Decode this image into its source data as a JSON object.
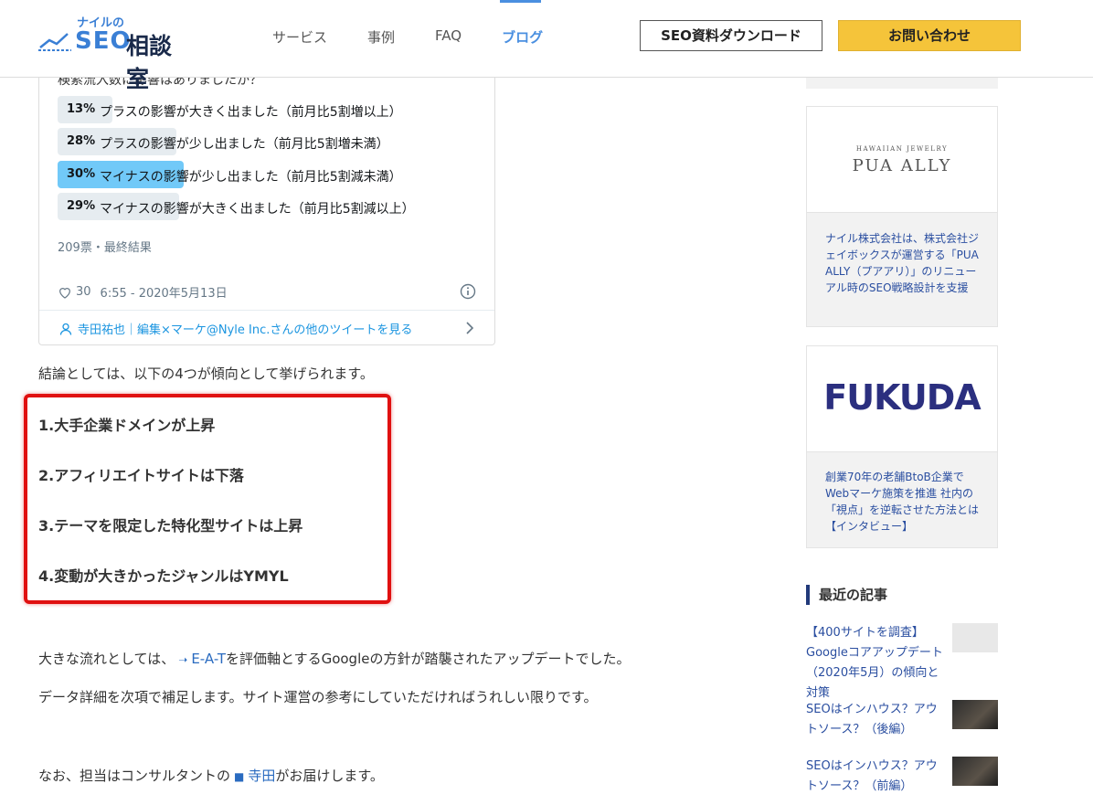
{
  "header": {
    "logo_small": "ナイルの",
    "logo_seo": "SEO",
    "logo_jp": "相談室",
    "nav": [
      {
        "label": "サービス"
      },
      {
        "label": "事例"
      },
      {
        "label": "FAQ"
      },
      {
        "label": "ブログ"
      }
    ],
    "download_button": "SEO資料ダウンロード",
    "contact_button": "お問い合わせ",
    "colors": {
      "accent": "#4a8fe0",
      "contact_bg": "#f5c43a"
    }
  },
  "tweet": {
    "question": "検索流入数に影響はありましたか？",
    "poll": [
      {
        "pct": "13%",
        "value": 13,
        "label": "プラスの影響が大きく出ました（前月比5割増以上）"
      },
      {
        "pct": "28%",
        "value": 28,
        "label": "プラスの影響が少し出ました（前月比5割増未満）"
      },
      {
        "pct": "30%",
        "value": 30,
        "label": "マイナスの影響が少し出ました（前月比5割減未満）",
        "winner": true
      },
      {
        "pct": "29%",
        "value": 29,
        "label": "マイナスの影響が大きく出ました（前月比5割減以上）"
      }
    ],
    "votes": "209票・最終結果",
    "likes": "30",
    "timestamp": "6:55 - 2020年5月13日",
    "footer_link": "寺田祐也｜編集×マーケ@Nyle Inc.さんの他のツイートを見る",
    "icons": {
      "like": "heart-icon",
      "info": "info-icon",
      "user": "user-icon",
      "chevron": "chevron-right-icon"
    }
  },
  "article": {
    "intro": "結論としては、以下の4つが傾向として挙げられます。",
    "list": [
      "1.大手企業ドメインが上昇",
      "2.アフィリエイトサイトは下落",
      "3.テーマを限定した特化型サイトは上昇",
      "4.変動が大きかったジャンルはYMYL"
    ],
    "p1_before": "大きな流れとしては、",
    "p1_link": "E-A-T",
    "p1_after": "を評価軸とするGoogleの方針が踏襲されたアップデートでした。",
    "p2": "データ詳細を次項で補足します。サイト運営の参考にしていただければうれしい限りです。",
    "p3_before": "なお、担当はコンサルタントの",
    "p3_link": "寺田",
    "p3_after": "がお届けします。",
    "highlight_color": "#e01010"
  },
  "sidebar": {
    "ad1": {
      "brand_small": "HAWAIIAN JEWELRY",
      "brand": "PUA ALLY",
      "desc": "ナイル株式会社は、株式会社ジェイボックスが運営する「PUA ALLY（プアアリ）」のリニューアル時のSEO戦略設計を支援"
    },
    "ad2": {
      "brand": "FUKUDA",
      "desc": "創業70年の老舗BtoB企業でWebマーケ施策を推進 社内の「視点」を逆転させた方法とは【インタビュー】"
    },
    "recent_heading": "最近の記事",
    "recent": [
      {
        "title": "【400サイトを調査】Googleコアアップデート（2020年5月）の傾向と対策"
      },
      {
        "title": "SEOはインハウス？アウトソース？（後編）"
      },
      {
        "title": "SEOはインハウス？アウトソース？（前編）"
      }
    ]
  }
}
